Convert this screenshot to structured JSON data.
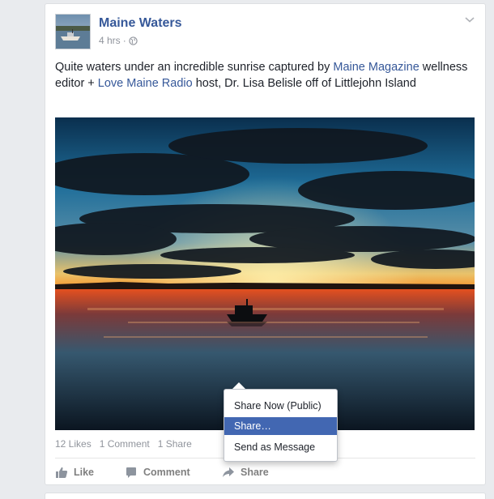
{
  "post": {
    "page_name": "Maine Waters",
    "timestamp": "4 hrs",
    "separator": "·",
    "text": {
      "part1": "Quite waters under an incredible sunrise captured by ",
      "link1": "Maine Magazine",
      "part2": " wellness editor + ",
      "link2": "Love Maine Radio",
      "part3": " host, Dr. Lisa Belisle off of Littlejohn Island"
    },
    "counts": {
      "likes": "12 Likes",
      "comments": "1 Comment",
      "shares": "1 Share"
    },
    "actions": {
      "like": "Like",
      "comment": "Comment",
      "share": "Share"
    }
  },
  "share_menu": {
    "items": [
      "Share Now (Public)",
      "Share…",
      "Send as Message"
    ],
    "highlighted_index": 1
  },
  "colors": {
    "link": "#365899",
    "menu_highlight": "#4267b2",
    "meta_gray": "#90949c"
  },
  "icons": {
    "privacy": "globe-icon",
    "options": "chevron-down-icon",
    "like": "thumbs-up-icon",
    "comment": "comment-bubble-icon",
    "share": "share-arrow-icon"
  }
}
